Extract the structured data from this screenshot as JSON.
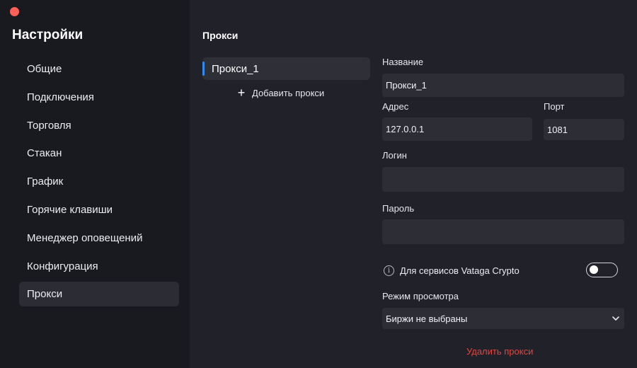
{
  "sidebar": {
    "title": "Настройки",
    "items": [
      {
        "label": "Общие"
      },
      {
        "label": "Подключения"
      },
      {
        "label": "Торговля"
      },
      {
        "label": "Стакан"
      },
      {
        "label": "График"
      },
      {
        "label": "Горячие клавиши"
      },
      {
        "label": "Менеджер оповещений"
      },
      {
        "label": "Конфигурация"
      },
      {
        "label": "Прокси",
        "active": true
      }
    ]
  },
  "proxies": {
    "section_title": "Прокси",
    "list": [
      {
        "label": "Прокси_1",
        "selected": true
      }
    ],
    "add_label": "Добавить прокси"
  },
  "form": {
    "name_label": "Название",
    "name_value": "Прокси_1",
    "address_label": "Адрес",
    "address_value": "127.0.0.1",
    "port_label": "Порт",
    "port_value": "1081",
    "login_label": "Логин",
    "login_value": "",
    "password_label": "Пароль",
    "password_value": "",
    "services_toggle_label": "Для сервисов Vataga Crypto",
    "services_toggle_on": false,
    "view_mode_label": "Режим просмотра",
    "view_mode_value": "Биржи не выбраны",
    "delete_label": "Удалить прокси"
  },
  "colors": {
    "accent": "#2f8cf2",
    "danger": "#e5453f",
    "window_close": "#fe5f57"
  }
}
